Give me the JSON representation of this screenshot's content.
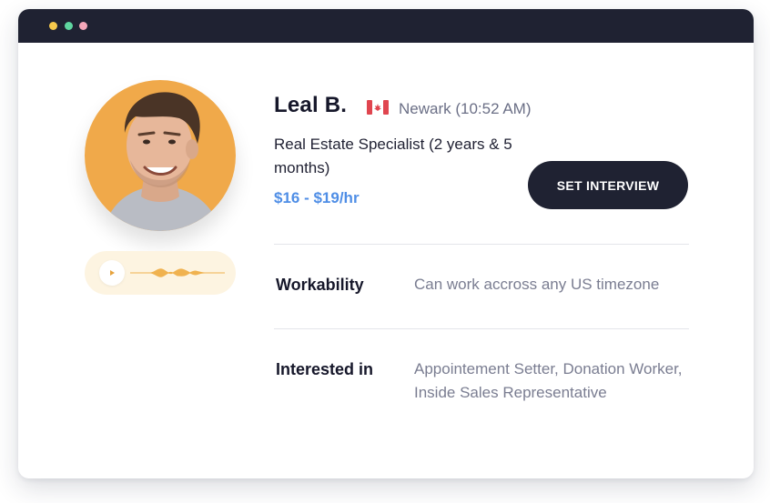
{
  "window": {
    "titlebar_color": "#1f2232",
    "dots": [
      {
        "name": "yellow",
        "color": "#f5c84c"
      },
      {
        "name": "green",
        "color": "#5fd6a0"
      },
      {
        "name": "pink",
        "color": "#f4a7b9"
      }
    ]
  },
  "profile": {
    "name": "Leal B.",
    "country_flag_icon": "canada-flag-icon",
    "location": "Newark (10:52 AM)",
    "role": "Real Estate Specialist (2 years & 5 months)",
    "rate": "$16 - $19/hr",
    "avatar_background": "#f0a94a",
    "rate_color": "#4f8ee6"
  },
  "audio": {
    "play_icon": "play-icon",
    "waveform_color": "#f0b24f"
  },
  "actions": {
    "set_interview_label": "SET INTERVIEW"
  },
  "details": [
    {
      "label": "Workability",
      "value": "Can work accross any US timezone"
    },
    {
      "label": "Interested in",
      "value": "Appointement Setter, Donation Worker, Inside Sales Representative"
    }
  ]
}
